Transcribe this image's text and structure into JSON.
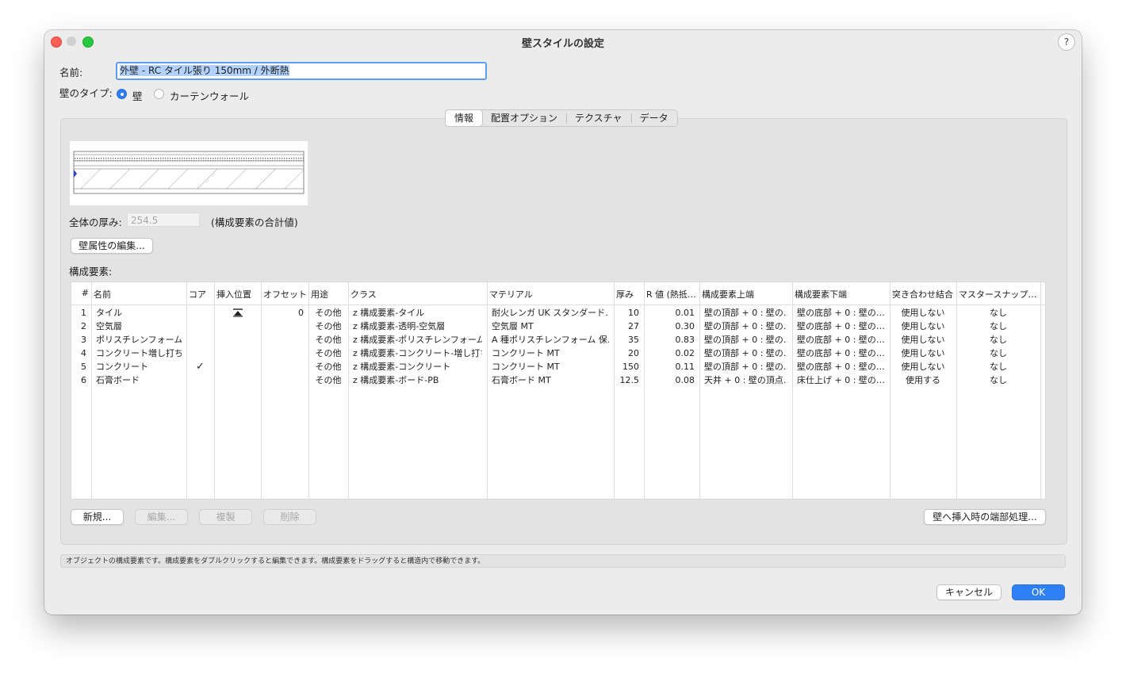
{
  "window": {
    "title": "壁スタイルの設定",
    "help": "?"
  },
  "name_label": "名前:",
  "name_value": "外壁 - RC タイル張り 150mm / 外断熱",
  "type_label": "壁のタイプ:",
  "type_options": [
    "壁",
    "カーテンウォール"
  ],
  "type_selected": "壁",
  "tabs": [
    "情報",
    "配置オプション",
    "テクスチャ",
    "データ"
  ],
  "active_tab": "情報",
  "total_thickness_label": "全体の厚み:",
  "total_thickness_value": "254.5",
  "total_thickness_note": "(構成要素の合計値)",
  "edit_attributes_button": "壁属性の編集...",
  "components_label": "構成要素:",
  "columns": [
    "#",
    "名前",
    "コア",
    "挿入位置",
    "オフセット",
    "用途",
    "クラス",
    "マテリアル",
    "厚み",
    "R 値 (熱抵…",
    "構成要素上端",
    "構成要素下端",
    "突き合わせ結合",
    "マスタースナップ…"
  ],
  "rows": [
    [
      "1",
      "タイル",
      "",
      "insert",
      "0",
      "その他",
      "z 構成要素-タイル",
      "耐火レンガ UK スタンダード…",
      "10",
      "0.01",
      "壁の頂部 + 0 : 壁の…",
      "壁の底部 + 0 : 壁の…",
      "使用しない",
      "なし"
    ],
    [
      "2",
      "空気層",
      "",
      "",
      "",
      "その他",
      "z 構成要素-透明-空気層",
      "空気層 MT",
      "27",
      "0.30",
      "壁の頂部 + 0 : 壁の…",
      "壁の底部 + 0 : 壁の…",
      "使用しない",
      "なし"
    ],
    [
      "3",
      "ポリスチレンフォーム",
      "",
      "",
      "",
      "その他",
      "z 構成要素-ポリスチレンフォーム",
      "A 種ポリスチレンフォーム 保…",
      "35",
      "0.83",
      "壁の頂部 + 0 : 壁の…",
      "壁の底部 + 0 : 壁の…",
      "使用しない",
      "なし"
    ],
    [
      "4",
      "コンクリート増し打ち",
      "",
      "",
      "",
      "その他",
      "z 構成要素-コンクリート-増し打ち",
      "コンクリート MT",
      "20",
      "0.02",
      "壁の頂部 + 0 : 壁の…",
      "壁の底部 + 0 : 壁の…",
      "使用しない",
      "なし"
    ],
    [
      "5",
      "コンクリート",
      "✓",
      "",
      "",
      "その他",
      "z 構成要素-コンクリート",
      "コンクリート MT",
      "150",
      "0.11",
      "壁の頂部 + 0 : 壁の…",
      "壁の底部 + 0 : 壁の…",
      "使用しない",
      "なし"
    ],
    [
      "6",
      "石膏ボード",
      "",
      "",
      "",
      "その他",
      "z 構成要素-ボード-PB",
      "石膏ボード MT",
      "12.5",
      "0.08",
      "天井 + 0 : 壁の頂点…",
      "床仕上げ + 0 : 壁の…",
      "使用する",
      "なし"
    ]
  ],
  "buttons": {
    "new": "新規...",
    "edit": "編集...",
    "duplicate": "複製",
    "delete": "削除",
    "end_treatment": "壁へ挿入時の端部処理...",
    "cancel": "キャンセル",
    "ok": "OK"
  },
  "status_text": "オブジェクトの構成要素です。構成要素をダブルクリックすると編集できます。構成要素をドラッグすると構造内で移動できます。",
  "colors": {
    "accent": "#2f7ff7",
    "selection": "#b3d2fb",
    "close": "#ff5f57",
    "zoom": "#28c840"
  }
}
